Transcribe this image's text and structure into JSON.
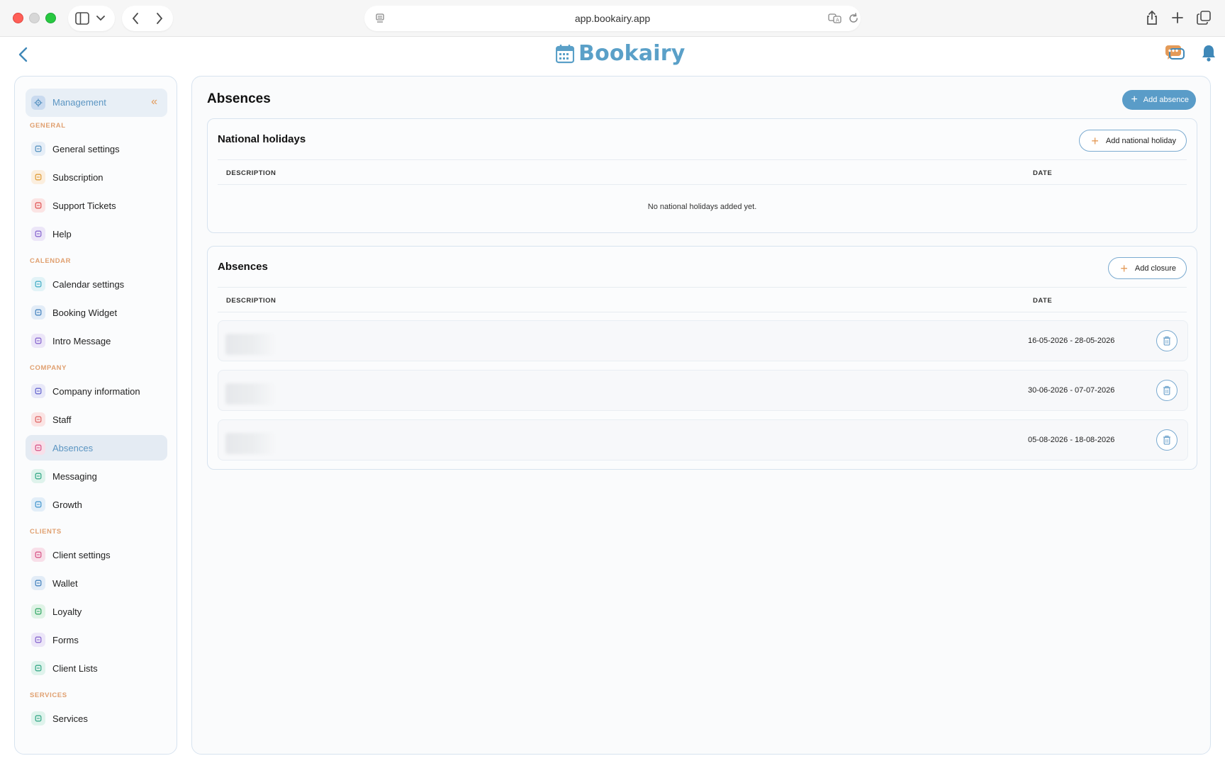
{
  "browser": {
    "url": "app.bookairy.app"
  },
  "header": {
    "logo_text": "Bookairy"
  },
  "sidebar": {
    "management_label": "Management",
    "sections": [
      {
        "title": "GENERAL",
        "items": [
          {
            "label": "General settings",
            "icon": "sliders-icon",
            "color": "#5b95c2",
            "bg": "#e6eef7"
          },
          {
            "label": "Subscription",
            "icon": "badge-icon",
            "color": "#e0a040",
            "bg": "#fbeede"
          },
          {
            "label": "Support Tickets",
            "icon": "headset-icon",
            "color": "#e05a5a",
            "bg": "#fbe4e4"
          },
          {
            "label": "Help",
            "icon": "question-icon",
            "color": "#8a6ad0",
            "bg": "#ece6f8"
          }
        ]
      },
      {
        "title": "CALENDAR",
        "items": [
          {
            "label": "Calendar settings",
            "icon": "calendar-icon",
            "color": "#4ab0c8",
            "bg": "#e2f3f7"
          },
          {
            "label": "Booking Widget",
            "icon": "widget-icon",
            "color": "#4a86c0",
            "bg": "#e2ecf7"
          },
          {
            "label": "Intro Message",
            "icon": "message-icon",
            "color": "#8a6ad0",
            "bg": "#ece6f8"
          }
        ]
      },
      {
        "title": "COMPANY",
        "items": [
          {
            "label": "Company information",
            "icon": "building-icon",
            "color": "#6a6ad0",
            "bg": "#e8e8f8"
          },
          {
            "label": "Staff",
            "icon": "people-icon",
            "color": "#e06a6a",
            "bg": "#fbe4e4"
          },
          {
            "label": "Absences",
            "icon": "calendar-x-icon",
            "color": "#d85a8a",
            "bg": "#f8dfe9",
            "active": true
          },
          {
            "label": "Messaging",
            "icon": "chat-icon",
            "color": "#3aaa8a",
            "bg": "#dff3ec"
          },
          {
            "label": "Growth",
            "icon": "trend-icon",
            "color": "#4a9ad0",
            "bg": "#e2eef8"
          }
        ]
      },
      {
        "title": "CLIENTS",
        "items": [
          {
            "label": "Client settings",
            "icon": "user-icon",
            "color": "#d85a8a",
            "bg": "#f8dfe9"
          },
          {
            "label": "Wallet",
            "icon": "wallet-icon",
            "color": "#4a86c0",
            "bg": "#e2ecf7"
          },
          {
            "label": "Loyalty",
            "icon": "tag-icon",
            "color": "#3aaa6a",
            "bg": "#dff3e6"
          },
          {
            "label": "Forms",
            "icon": "form-icon",
            "color": "#8a6ad0",
            "bg": "#ece6f8"
          },
          {
            "label": "Client Lists",
            "icon": "list-icon",
            "color": "#3aaa8a",
            "bg": "#dff3ec"
          }
        ]
      },
      {
        "title": "SERVICES",
        "items": [
          {
            "label": "Services",
            "icon": "service-tag-icon",
            "color": "#3aaa8a",
            "bg": "#dff3ec"
          }
        ]
      }
    ]
  },
  "main": {
    "title": "Absences",
    "add_absence_label": "Add absence",
    "national_holidays": {
      "title": "National holidays",
      "add_label": "Add national holiday",
      "col_description": "DESCRIPTION",
      "col_date": "DATE",
      "empty_message": "No national holidays added yet."
    },
    "absences": {
      "title": "Absences",
      "add_label": "Add closure",
      "col_description": "DESCRIPTION",
      "col_date": "DATE",
      "rows": [
        {
          "date": "16-05-2026 - 28-05-2026"
        },
        {
          "date": "30-06-2026 - 07-07-2026"
        },
        {
          "date": "05-08-2026 - 18-08-2026"
        }
      ]
    }
  },
  "colors": {
    "accent": "#5a9cc8",
    "accent_orange": "#e49a58"
  }
}
